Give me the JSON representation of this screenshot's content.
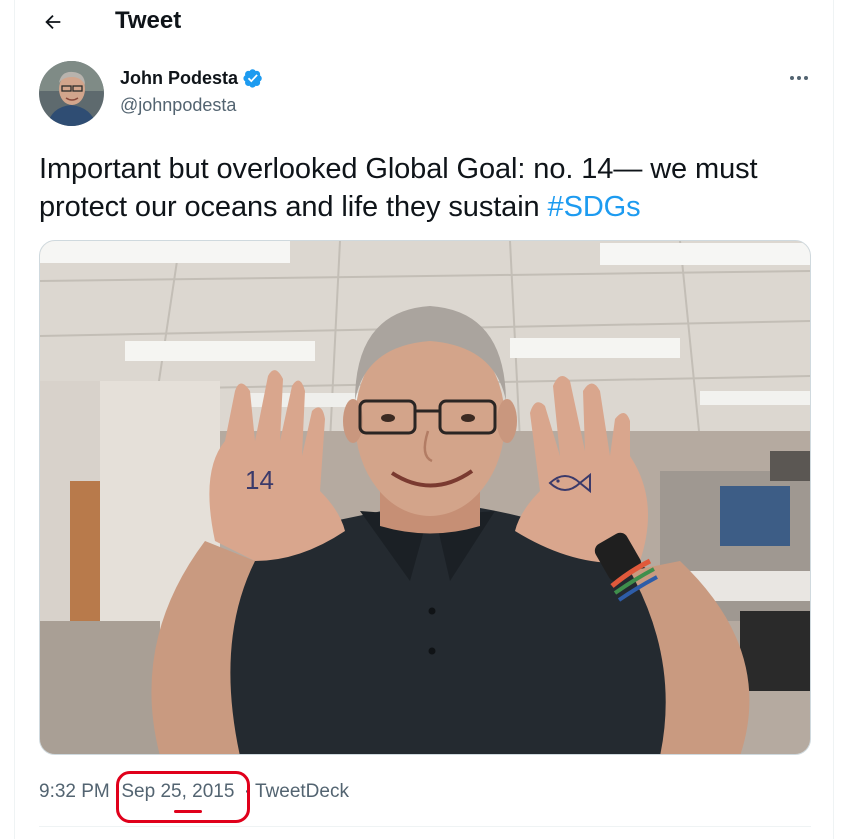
{
  "header": {
    "title": "Tweet",
    "back_icon": "arrow-left-icon"
  },
  "author": {
    "name": "John Podesta",
    "handle": "@johnpodesta",
    "verified": true,
    "verified_color": "#1d9bf0"
  },
  "tweet": {
    "text_before": "Important but overlooked Global Goal: no. 14— we must protect our oceans and life they sustain ",
    "hashtag": "#SDGs",
    "hashtag_color": "#1d9bf0"
  },
  "photo": {
    "hand_left_text": "14"
  },
  "meta": {
    "time": "9:32 PM",
    "separator": "·",
    "date": "Sep 25, 2015",
    "source": "TweetDeck",
    "annotation_color": "#e0001b"
  },
  "icons": {
    "back": "arrow-left-icon",
    "more": "more-horizontal-icon",
    "verified": "verified-badge-icon"
  }
}
